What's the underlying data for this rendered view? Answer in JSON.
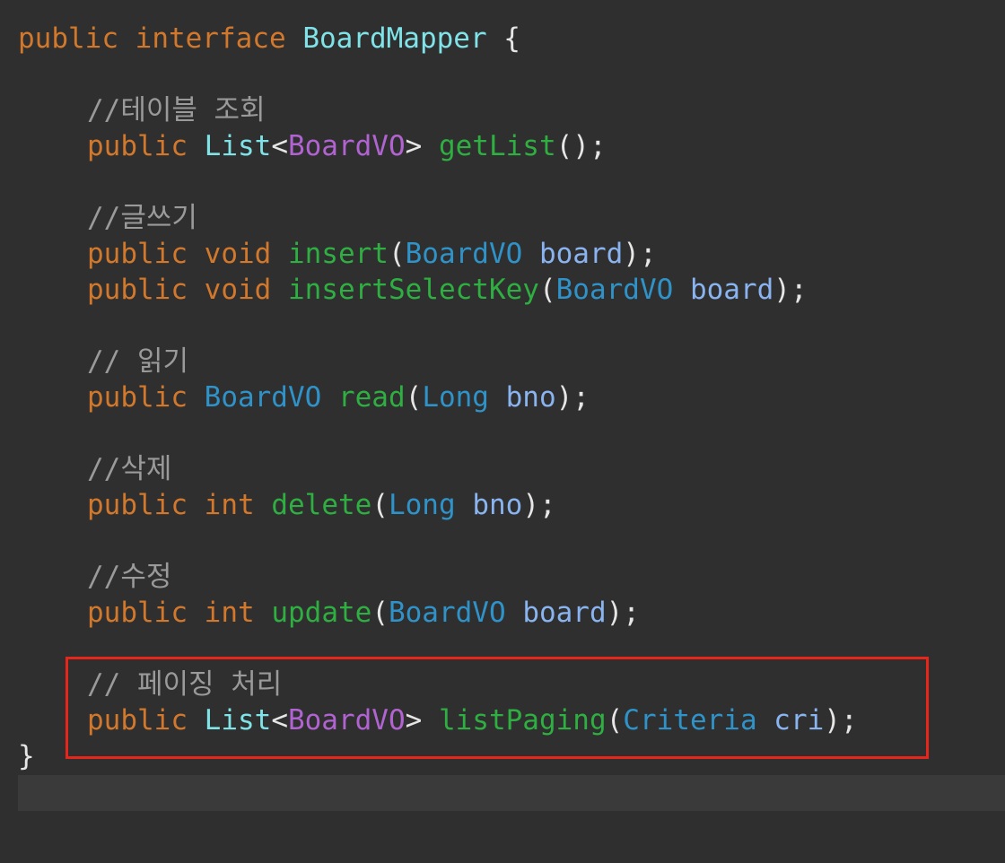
{
  "code": {
    "interface_decl": {
      "kw_public": "public",
      "kw_interface": "interface",
      "name": "BoardMapper",
      "brace_open": " {"
    },
    "comment_list": "//테이블 조회",
    "get_list": {
      "kw_public": "public",
      "type_list": "List",
      "lt": "<",
      "generic": "BoardVO",
      "gt": ">",
      "method": "getList",
      "rest": "();"
    },
    "comment_insert": "//글쓰기",
    "insert": {
      "kw_public": "public",
      "kw_void": "void",
      "method": "insert",
      "open": "(",
      "param_type": "BoardVO",
      "param_name": "board",
      "close": ");"
    },
    "insert_select_key": {
      "kw_public": "public",
      "kw_void": "void",
      "method": "insertSelectKey",
      "open": "(",
      "param_type": "BoardVO",
      "param_name": "board",
      "close": ");"
    },
    "comment_read": "// 읽기",
    "read": {
      "kw_public": "public",
      "return_type": "BoardVO",
      "method": "read",
      "open": "(",
      "param_type": "Long",
      "param_name": "bno",
      "close": ");"
    },
    "comment_delete": "//삭제",
    "delete": {
      "kw_public": "public",
      "kw_int": "int",
      "method": "delete",
      "open": "(",
      "param_type": "Long",
      "param_name": "bno",
      "close": ");"
    },
    "comment_update": "//수정",
    "update": {
      "kw_public": "public",
      "kw_int": "int",
      "method": "update",
      "open": "(",
      "param_type": "BoardVO",
      "param_name": "board",
      "close": ");"
    },
    "comment_paging": "// 페이징 처리",
    "list_paging": {
      "kw_public": "public",
      "type_list": "List",
      "lt": "<",
      "generic": "BoardVO",
      "gt": ">",
      "method": "listPaging",
      "open": "(",
      "param_type": "Criteria",
      "param_name": "cri",
      "close": ");"
    },
    "brace_close": "}"
  },
  "colors": {
    "background": "#2f2f2f",
    "keyword": "#d2782c",
    "class_name": "#7fe3e8",
    "generic_type": "#b163d1",
    "method_name": "#2fae41",
    "param_type": "#2f93c9",
    "param_name": "#8ab4f0",
    "punctuation": "#e6e6e6",
    "comment": "#9a9a9a",
    "highlight_border": "#e8251a"
  }
}
